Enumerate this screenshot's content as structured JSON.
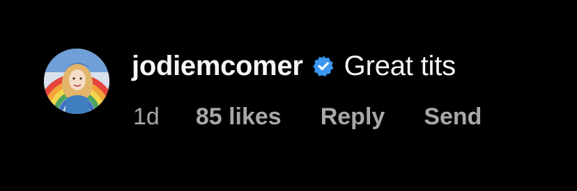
{
  "comment": {
    "username": "jodiemcomer",
    "verified_icon": "verified-badge-icon",
    "text": "Great tits",
    "timestamp": "1d",
    "likes": "85 likes",
    "reply_label": "Reply",
    "send_label": "Send"
  },
  "colors": {
    "background": "#000000",
    "primary_text": "#f5f5f5",
    "secondary_text": "#a8a8a8",
    "verified_blue": "#3b97f0"
  }
}
